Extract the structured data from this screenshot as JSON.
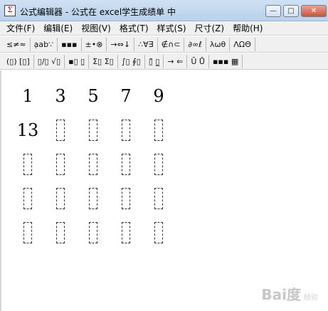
{
  "window": {
    "title": "公式编辑器 - 公式在 excel学生成绩单 中",
    "icon_glyph": "Σ",
    "controls": {
      "minimize": "—",
      "maximize": "□",
      "close": "✕"
    }
  },
  "menu": [
    {
      "label": "文件(F)"
    },
    {
      "label": "编辑(E)"
    },
    {
      "label": "视图(V)"
    },
    {
      "label": "格式(T)"
    },
    {
      "label": "样式(S)"
    },
    {
      "label": "尺寸(Z)"
    },
    {
      "label": "帮助(H)"
    }
  ],
  "toolbar_row1": [
    {
      "label": "≤≠≈",
      "icon": "relations-palette-icon"
    },
    {
      "label": "ạab∵",
      "icon": "spaces-palette-icon"
    },
    {
      "label": "▪▪▪",
      "icon": "embellishments-palette-icon"
    },
    {
      "label": "±•⊗",
      "icon": "operators-palette-icon"
    },
    {
      "label": "→⇔↓",
      "icon": "arrows-palette-icon"
    },
    {
      "label": "∴∀∃",
      "icon": "logic-palette-icon"
    },
    {
      "label": "∉∩⊂",
      "icon": "sets-palette-icon"
    },
    {
      "label": "∂∞ℓ",
      "icon": "misc-symbols-palette-icon"
    },
    {
      "label": "λωθ",
      "icon": "greek-lower-palette-icon"
    },
    {
      "label": "ΛΩΘ",
      "icon": "greek-upper-palette-icon"
    }
  ],
  "toolbar_row2": [
    {
      "label": "(▯) [▯]",
      "icon": "fences-palette-icon"
    },
    {
      "label": "▯/▯ √▯",
      "icon": "fraction-radical-palette-icon"
    },
    {
      "label": "▪▯ ▯̱",
      "icon": "subscript-superscript-palette-icon"
    },
    {
      "label": "Σ▯ Σ▯",
      "icon": "summation-palette-icon"
    },
    {
      "label": "∫▯ ∮▯",
      "icon": "integral-palette-icon"
    },
    {
      "label": "▯̄ ▯̲",
      "icon": "underbar-overbar-palette-icon"
    },
    {
      "label": "→ ⇐",
      "icon": "labeled-arrows-palette-icon"
    },
    {
      "label": "Ū Ů",
      "icon": "products-palette-icon"
    },
    {
      "label": "▪▪▪ ▦",
      "icon": "matrix-palette-icon"
    }
  ],
  "matrix": {
    "rows": 5,
    "cols": 5,
    "values": [
      [
        "1",
        "3",
        "5",
        "7",
        "9"
      ],
      [
        "13",
        null,
        null,
        null,
        null
      ],
      [
        null,
        null,
        null,
        null,
        null
      ],
      [
        null,
        null,
        null,
        null,
        null
      ],
      [
        null,
        null,
        null,
        null,
        null
      ]
    ]
  },
  "watermark": {
    "brand": "Bai度",
    "sub": "经验"
  }
}
